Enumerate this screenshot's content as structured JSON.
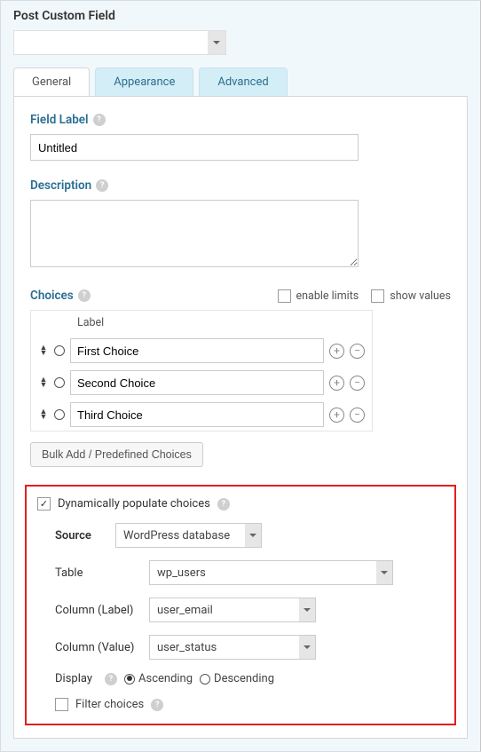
{
  "panel_title": "Post Custom Field",
  "tabs": {
    "general": "General",
    "appearance": "Appearance",
    "advanced": "Advanced"
  },
  "general": {
    "field_label_heading": "Field Label",
    "field_label_value": "Untitled",
    "description_heading": "Description",
    "description_value": "",
    "choices_heading": "Choices",
    "enable_limits_label": "enable limits",
    "show_values_label": "show values",
    "choices_table_header": "Label",
    "choices": [
      {
        "label": "First Choice"
      },
      {
        "label": "Second Choice"
      },
      {
        "label": "Third Choice"
      }
    ],
    "bulk_button": "Bulk Add / Predefined Choices"
  },
  "dynamic": {
    "checkbox_label": "Dynamically populate choices",
    "checked": true,
    "source_label": "Source",
    "source_value": "WordPress database",
    "table_label": "Table",
    "table_value": "wp_users",
    "col_label_label": "Column (Label)",
    "col_label_value": "user_email",
    "col_value_label": "Column (Value)",
    "col_value_value": "user_status",
    "display_label": "Display",
    "ascending_label": "Ascending",
    "descending_label": "Descending",
    "sort": "ascending",
    "filter_label": "Filter choices"
  }
}
